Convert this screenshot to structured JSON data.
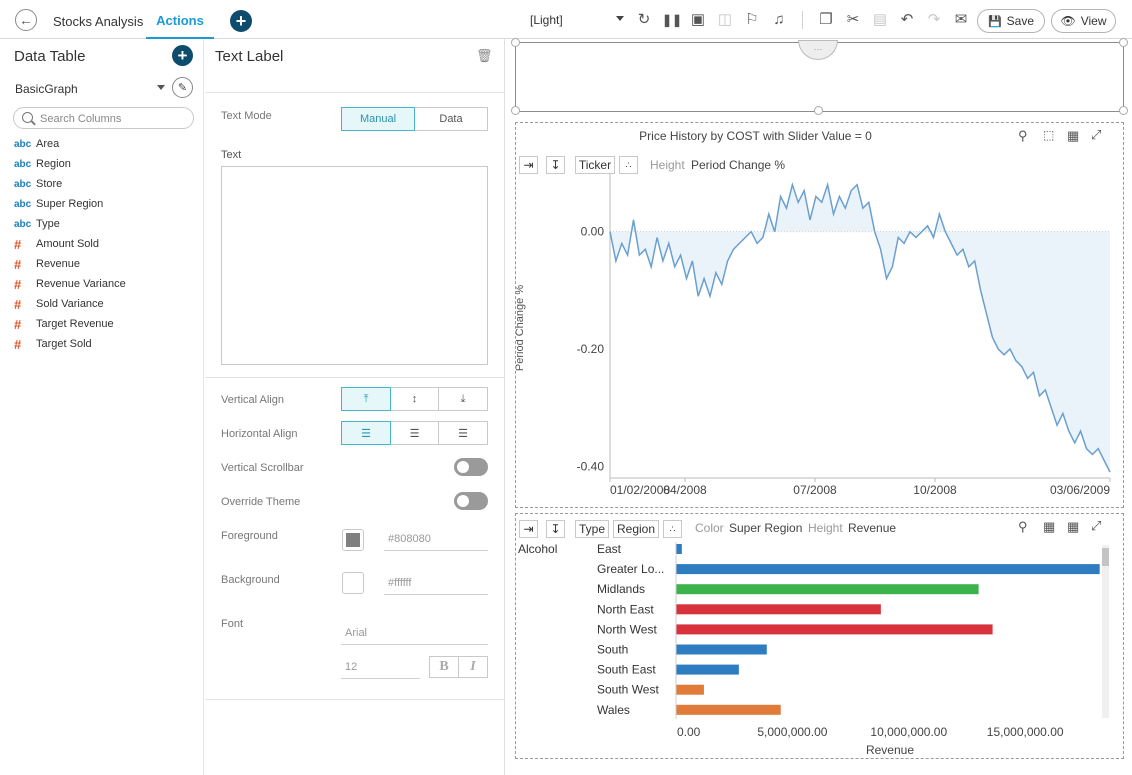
{
  "topbar": {
    "back_icon": "arrow-left-icon",
    "tab_stocks": "Stocks Analysis",
    "tab_actions": "Actions",
    "add_tab_icon": "plus-icon",
    "theme": "[Light]",
    "save_label": "Save",
    "view_label": "View",
    "accent_color": "#1a9bd7"
  },
  "data_table": {
    "title": "Data Table",
    "datasource": "BasicGraph",
    "search_placeholder": "Search Columns",
    "columns": [
      {
        "type": "abc",
        "name": "Area"
      },
      {
        "type": "abc",
        "name": "Region"
      },
      {
        "type": "abc",
        "name": "Store"
      },
      {
        "type": "abc",
        "name": "Super Region"
      },
      {
        "type": "abc",
        "name": "Type"
      },
      {
        "type": "#",
        "name": "Amount Sold"
      },
      {
        "type": "#",
        "name": "Revenue"
      },
      {
        "type": "#",
        "name": "Revenue Variance"
      },
      {
        "type": "#",
        "name": "Sold Variance"
      },
      {
        "type": "#",
        "name": "Target Revenue"
      },
      {
        "type": "#",
        "name": "Target Sold"
      }
    ]
  },
  "text_label": {
    "title": "Text Label",
    "text_mode_label": "Text Mode",
    "mode_manual": "Manual",
    "mode_data": "Data",
    "text_label": "Text",
    "text_value": "",
    "vertical_align_label": "Vertical Align",
    "horizontal_align_label": "Horizontal Align",
    "vertical_scrollbar_label": "Vertical Scrollbar",
    "override_theme_label": "Override Theme",
    "foreground_label": "Foreground",
    "foreground_value": "#808080",
    "background_label": "Background",
    "background_value": "#ffffff",
    "font_label": "Font",
    "font_name": "Arial",
    "font_size": "12",
    "bold_label": "B",
    "italic_label": "I"
  },
  "line_panel": {
    "title": "Price History by COST with Slider Value = 0",
    "ticker_btn": "Ticker",
    "height_label": "Height",
    "height_value": "Period Change %"
  },
  "bar_panel": {
    "type_btn": "Type",
    "region_btn": "Region",
    "color_label": "Color",
    "color_value": "Super Region",
    "height_label": "Height",
    "height_value": "Revenue"
  },
  "chart_data": [
    {
      "type": "area",
      "ylabel": "Period Change %",
      "ylim": [
        -0.42,
        0.1
      ],
      "yticks": [
        "0.00",
        "-0.20",
        "-0.40"
      ],
      "yticks_values": [
        0,
        -0.2,
        -0.4
      ],
      "xticks": [
        "01/02/2008",
        "04/2008",
        "07/2008",
        "10/2008",
        "03/06/2009"
      ],
      "xticks_values": [
        0,
        0.15,
        0.41,
        0.65,
        1
      ],
      "series": [
        {
          "color": "#6a9fcf",
          "values": [
            0,
            -0.05,
            -0.02,
            -0.04,
            0.02,
            -0.04,
            -0.03,
            -0.06,
            -0.01,
            -0.05,
            -0.02,
            -0.06,
            -0.04,
            -0.08,
            -0.05,
            -0.11,
            -0.08,
            -0.11,
            -0.07,
            -0.09,
            -0.05,
            -0.03,
            -0.02,
            -0.01,
            0.0,
            -0.02,
            -0.01,
            0.03,
            0.0,
            0.06,
            0.04,
            0.08,
            0.05,
            0.07,
            0.02,
            0.06,
            0.05,
            0.08,
            0.03,
            0.06,
            0.04,
            0.07,
            0.08,
            0.04,
            0.05,
            0.0,
            -0.03,
            -0.08,
            -0.06,
            -0.01,
            -0.02,
            0.0,
            -0.01,
            0.0,
            0.01,
            -0.01,
            0.03,
            0.0,
            -0.02,
            -0.04,
            -0.03,
            -0.06,
            -0.05,
            -0.1,
            -0.14,
            -0.18,
            -0.2,
            -0.21,
            -0.2,
            -0.22,
            -0.23,
            -0.25,
            -0.24,
            -0.28,
            -0.27,
            -0.3,
            -0.33,
            -0.31,
            -0.34,
            -0.36,
            -0.34,
            -0.37,
            -0.38,
            -0.37,
            -0.39,
            -0.41
          ]
        }
      ]
    },
    {
      "type": "bar",
      "orientation": "horizontal",
      "group": "Alcohol",
      "categories": [
        "East",
        "Greater Lo...",
        "Midlands",
        "North East",
        "North West",
        "South",
        "South East",
        "South West",
        "Wales"
      ],
      "values": [
        250000,
        18200000,
        13000000,
        8800000,
        13600000,
        3900000,
        2700000,
        1200000,
        4500000
      ],
      "colors": [
        "#2e7dc0",
        "#2e7dc0",
        "#3cb44b",
        "#d8323c",
        "#d8323c",
        "#2e7dc0",
        "#2e7dc0",
        "#e07b39",
        "#e07b39"
      ],
      "xlabel": "Revenue",
      "xticks": [
        "0.00",
        "5,000,000.00",
        "10,000,000.00",
        "15,000,000.00"
      ],
      "xticks_values": [
        0,
        5000000,
        10000000,
        15000000
      ],
      "xlim": [
        0,
        18300000
      ]
    }
  ]
}
